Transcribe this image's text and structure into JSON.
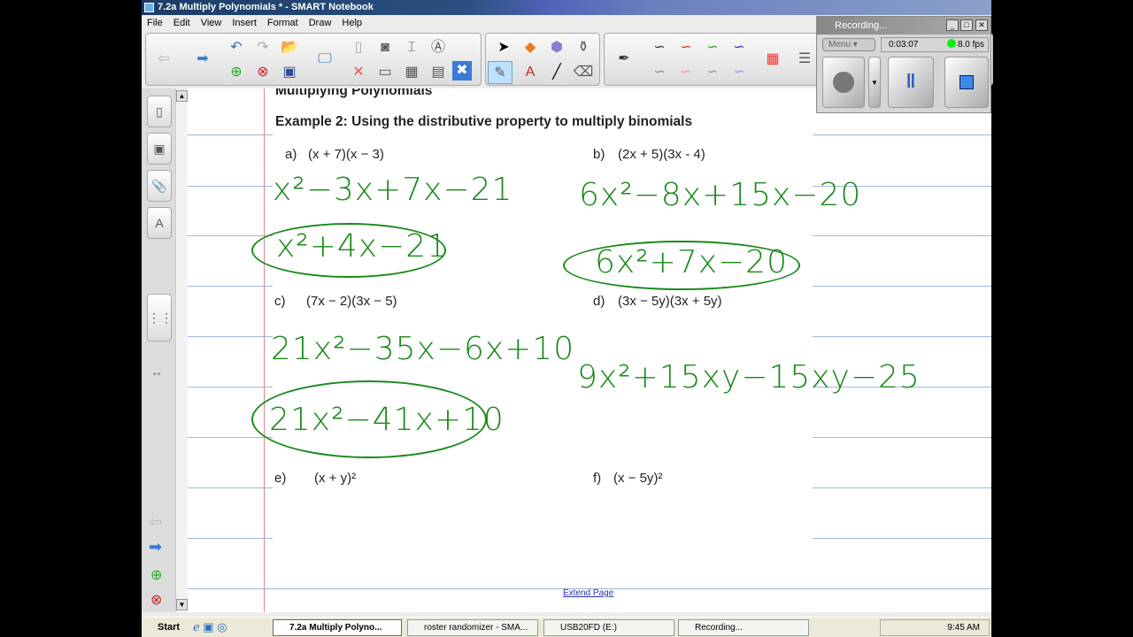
{
  "window": {
    "title": "7.2a Multiply Polynomials * - SMART Notebook"
  },
  "menu": [
    "File",
    "Edit",
    "View",
    "Insert",
    "Format",
    "Draw",
    "Help"
  ],
  "page": {
    "heading": "Multiplying Polynomials",
    "example": "Example 2:  Using the distributive property to multiply binomials",
    "problems": [
      {
        "label": "a)",
        "expr": "(x + 7)(x − 3)",
        "work": "x²−3x+7x−21",
        "answer": "x²+4x−21"
      },
      {
        "label": "b)",
        "expr": "(2x + 5)(3x - 4)",
        "work": "6x²−8x+15x−20",
        "answer": "6x²+7x−20"
      },
      {
        "label": "c)",
        "expr": "(7x − 2)(3x − 5)",
        "work": "21x²−35x−6x+10",
        "answer": "21x²−41x+10"
      },
      {
        "label": "d)",
        "expr": "(3x − 5y)(3x + 5y)",
        "work": "9x²+15xy−15xy−25"
      },
      {
        "label": "e)",
        "expr": "(x + y)²"
      },
      {
        "label": "f)",
        "expr": "(x − 5y)²"
      }
    ],
    "extend": "Extend Page"
  },
  "recorder": {
    "title": "Recording...",
    "menu": "Menu",
    "time": "0:03:07",
    "fps": "8.0 fps"
  },
  "taskbar": {
    "start": "Start",
    "tasks": [
      "7.2a Multiply Polyno...",
      "roster randomizer - SMA...",
      "USB20FD (E:)",
      "Recording..."
    ],
    "clock": "9:45 AM"
  }
}
